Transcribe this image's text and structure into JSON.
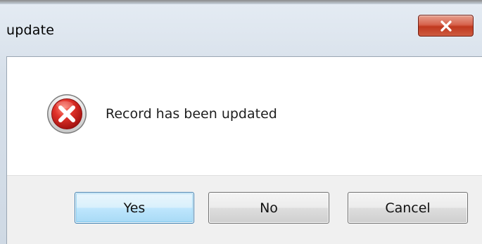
{
  "window": {
    "title": "update",
    "close_icon": "close-x-icon"
  },
  "dialog": {
    "icon": "error-icon",
    "message": "Record has been updated"
  },
  "buttons": {
    "yes": "Yes",
    "no": "No",
    "cancel": "Cancel"
  },
  "colors": {
    "close_button": "#c7472c",
    "error_icon": "#d62020",
    "default_button_border": "#3c7fb1",
    "footer_background": "#f0f0f0"
  }
}
